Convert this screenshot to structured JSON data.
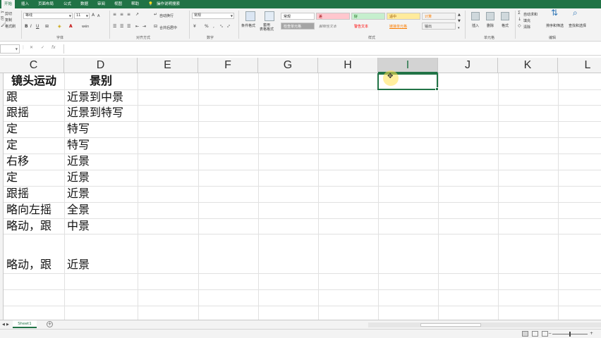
{
  "ribbon": {
    "tabs": [
      "开始",
      "插入",
      "页面布局",
      "公式",
      "数据",
      "审阅",
      "视图",
      "帮助"
    ],
    "tell_me": "操作说明搜索",
    "clipboard": {
      "cut": "剪切",
      "copy": "复制",
      "format_painter": "格式刷"
    },
    "font": {
      "name": "等线",
      "size": "11",
      "group_label": "字体"
    },
    "alignment": {
      "wrap_text": "自动换行",
      "merge_center": "合并后居中",
      "group_label": "对齐方式"
    },
    "number": {
      "format": "常规",
      "percent": "%",
      "comma": ",",
      "group_label": "数字"
    },
    "styles": {
      "conditional_formatting": "条件格式",
      "format_as_table": "套用\n表格格式",
      "group_label": "样式",
      "cells": [
        {
          "label": "常规",
          "bg": "#ffffff",
          "fg": "#222222"
        },
        {
          "label": "差",
          "bg": "#ffc7ce",
          "fg": "#9c0006"
        },
        {
          "label": "好",
          "bg": "#c6efce",
          "fg": "#006100"
        },
        {
          "label": "适中",
          "bg": "#ffeb9c",
          "fg": "#9c5700"
        },
        {
          "label": "计算",
          "bg": "#f2f2f2",
          "fg": "#fa7d00"
        },
        {
          "label": "检查单元格",
          "bg": "#a5a5a5",
          "fg": "#ffffff"
        },
        {
          "label": "解释性文本",
          "bg": "#f3f3f3",
          "fg": "#7f7f7f"
        },
        {
          "label": "警告文本",
          "bg": "#f3f3f3",
          "fg": "#ff0000"
        },
        {
          "label": "链接单元格",
          "bg": "#f3f3f3",
          "fg": "#fa7d00"
        },
        {
          "label": "输出",
          "bg": "#f2f2f2",
          "fg": "#3f3f3f"
        }
      ]
    },
    "cells_group": {
      "insert": "插入",
      "delete": "删除",
      "format": "格式",
      "group_label": "单元格"
    },
    "editing": {
      "autosum": "自动求和",
      "fill": "填充",
      "clear": "清除",
      "sort_filter": "排序和筛选",
      "find_select": "查找和选择",
      "group_label": "编辑"
    }
  },
  "formula_bar": {
    "name_box": "",
    "content": ""
  },
  "grid": {
    "columns": [
      "C",
      "D",
      "E",
      "F",
      "G",
      "H",
      "I",
      "J",
      "K",
      "L"
    ],
    "selected_column": "I",
    "header_row": {
      "C": "镜头运动",
      "D": "景别"
    },
    "rows": [
      {
        "C": "跟",
        "D": "近景到中景"
      },
      {
        "C": "跟摇",
        "D": "近景到特写"
      },
      {
        "C": "定",
        "D": "特写"
      },
      {
        "C": "定",
        "D": "特写"
      },
      {
        "C": "右移",
        "D": "近景"
      },
      {
        "C": "定",
        "D": "近景"
      },
      {
        "C": "跟摇",
        "D": "近景"
      },
      {
        "C": "略向左摇",
        "D": "全景"
      },
      {
        "C": "略动，跟",
        "D": "中景"
      },
      {
        "C": "略动，跟",
        "D": "近景"
      }
    ]
  },
  "sheets": [
    "Sheet1"
  ],
  "colors": {
    "accent": "#217346",
    "selected_header": "#d3d3d3"
  }
}
